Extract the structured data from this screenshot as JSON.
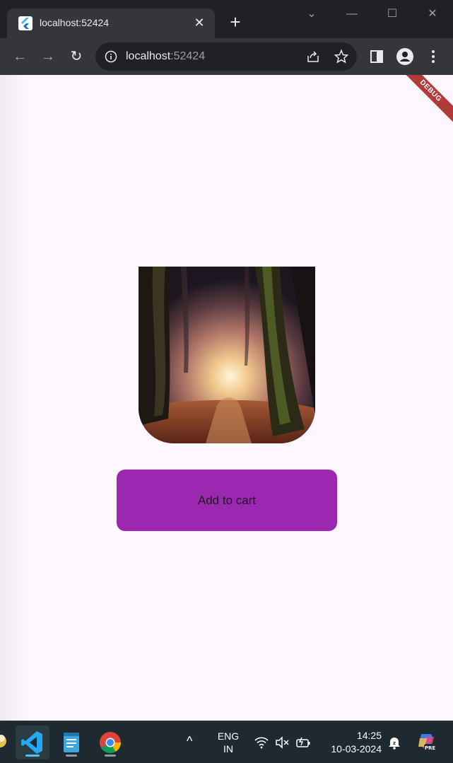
{
  "browser": {
    "tab_title": "localhost:52424",
    "url_host": "localhost",
    "url_port": ":52424"
  },
  "app": {
    "debug_label": "DEBUG",
    "add_to_cart_label": "Add to cart",
    "accent_color": "#9c27b0",
    "background_color": "#fef7ff"
  },
  "taskbar": {
    "lang_line1": "ENG",
    "lang_line2": "IN",
    "time": "14:25",
    "date": "10-03-2024"
  }
}
